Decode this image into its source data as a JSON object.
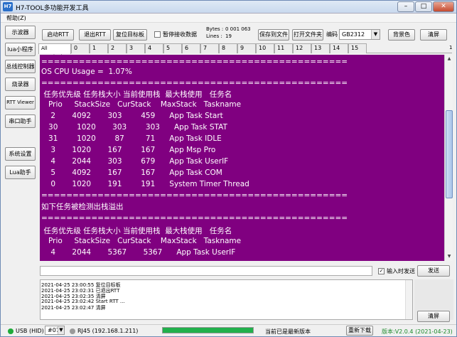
{
  "window": {
    "title": "H7-TOOL多功能开发工具",
    "app_icon": "H7",
    "minimize": "–",
    "maximize": "□",
    "close": "✕"
  },
  "menu": {
    "help": "帮助(Z)"
  },
  "sidebar": {
    "items": [
      "示波器",
      "lua小程序",
      "总线控制器",
      "烧录器",
      "RTT Viewer",
      "串口助手",
      "系统设置",
      "Lua助手"
    ]
  },
  "toolbar": {
    "start_rtt": "启动RTT",
    "exit_rtt": "退出RTT",
    "reset_target": "复位目标板",
    "pause_label": "暂停接收数据",
    "bytes_label": "Bytes :",
    "bytes_value": "0 001 063",
    "lines_label": "Lines :",
    "lines_value": "19",
    "save_file": "保存到文件",
    "open_folder": "打开文件夹",
    "encoding_label": "编码",
    "encoding_value": "GB2312",
    "background_color": "背景色",
    "clear_screen": "清屏"
  },
  "tabs": [
    "All Terminals",
    "0",
    "1",
    "2",
    "3",
    "4",
    "5",
    "6",
    "7",
    "8",
    "9",
    "10",
    "11",
    "12",
    "13",
    "14",
    "15"
  ],
  "tab_right_marker": "1",
  "terminal": {
    "lines": [
      "=================================================",
      "OS CPU Usage =  1.07%",
      "=================================================",
      " 任务优先级 任务栈大小 当前使用栈  最大栈使用   任务名",
      "   Prio     StackSize   CurStack    MaxStack   Taskname",
      "    2       4092       303        459      App Task Start",
      "   30        1020       303        303      App Task STAT",
      "   31        1020        87         71      App Task IDLE",
      "    3       1020       167        167      App Msp Pro",
      "    4       2044       303        679      App Task UserIF",
      "    5       4092       167        167      App Task COM",
      "    0       1020       191        191      System Timer Thread",
      "=================================================",
      "如下任务被检测出栈溢出",
      "=================================================",
      " 任务优先级 任务栈大小 当前使用栈  最大栈使用   任务名",
      "   Prio     StackSize   CurStack    MaxStack   Taskname",
      "    4       2044       5367       5367      App Task UserIF"
    ],
    "background": "#800080",
    "text_color": "#ffffff"
  },
  "send": {
    "input_value": "",
    "timed_send_label": "输入时发送",
    "timed_send_checked": true,
    "send_button": "发送"
  },
  "log": {
    "lines": [
      "2021-04-25 23:00:55 复位目标板",
      "2021-04-25 23:02:31 已退出RTT",
      "2021-04-25 23:02:35 清屏",
      "2021-04-25 23:02:42 Start RTT ...",
      "2021-04-25 23:02:47 清屏"
    ],
    "clear_button": "清屏"
  },
  "status": {
    "usb": "USB (HID)",
    "port": "#07",
    "rj45": "RJ45 (192.168.1.211)",
    "progress": 1.0,
    "message": "当前已是最新版本",
    "redownload": "重新下载",
    "version": "版本:V2.0.4 (2021-04-23)"
  }
}
